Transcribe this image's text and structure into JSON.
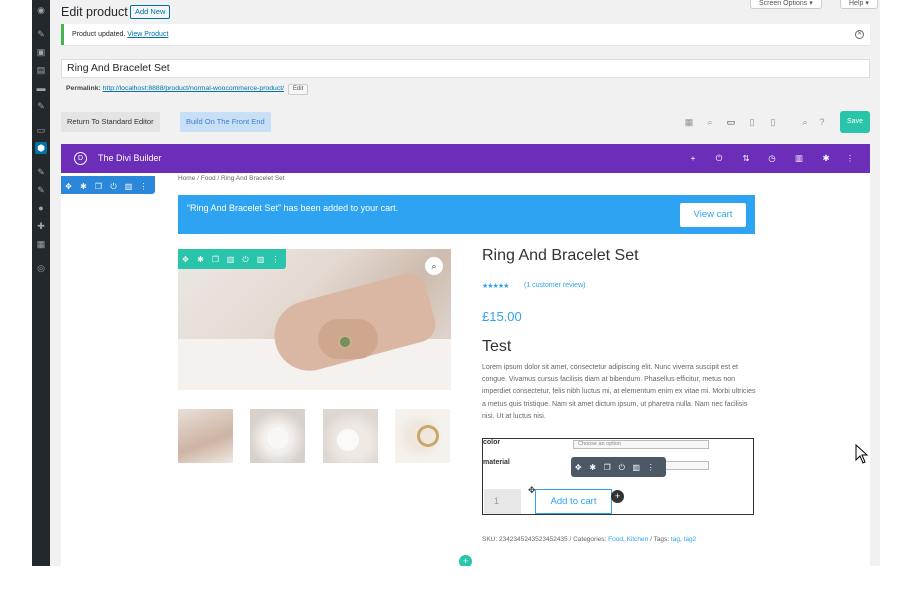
{
  "page": {
    "title": "Edit product",
    "add_new": "Add New"
  },
  "top_buttons": {
    "screen_options": "Screen Options ▾",
    "help": "Help ▾"
  },
  "notice": {
    "text": "Product updated.",
    "link": "View Product"
  },
  "post_title": "Ring And Bracelet Set",
  "permalink": {
    "label": "Permalink:",
    "url": "http://localhost:8888/product/normal-woocommerce-product/",
    "edit": "Edit"
  },
  "editor_buttons": {
    "standard": "Return To Standard Editor",
    "front_end": "Build On The Front End",
    "save": "Save"
  },
  "divi": {
    "logo": "D",
    "name": "The Divi Builder"
  },
  "breadcrumb": "Home / Food / Ring And Bracelet Set",
  "cart_message": {
    "text": "“Ring And Bracelet Set” has been added to your cart.",
    "button": "View cart"
  },
  "product": {
    "name": "Ring And Bracelet Set",
    "stars": "★★★★★",
    "rating": 4.5,
    "review": "(1 customer review)",
    "price": "£15.00",
    "heading": "Test",
    "description": "Lorem ipsum dolor sit amet, consectetur adipiscing elit. Nunc viverra suscipit est et congue. Vivamus cursus facilisis diam at bibendum. Phasellus efficitur, metus non imperdiet consectetur, felis nibh luctus mi, at elementum enim ex vitae mi. Morbi ultricies a metus quis tristique. Nam sit amet dictum ipsum, ut pharetra nulla. Nam nec facilisis nisi. Ut at luctus nisi.",
    "attributes": [
      {
        "label": "color",
        "placeholder": "Choose an option"
      },
      {
        "label": "material",
        "placeholder": ""
      }
    ],
    "quantity": "1",
    "add_to_cart": "Add to cart",
    "sku_prefix": "SKU: 2342345243523452435 / Categories: ",
    "category1": "Food",
    "category2": "Kitchen",
    "tags_prefix": " / Tags: ",
    "tag1": "tag",
    "tag2": "tag2"
  },
  "colors": {
    "divi_purple": "#6c2eb9",
    "accent_blue": "#2ea3f2",
    "teal": "#29c4a9",
    "row_blue": "#2b87da"
  }
}
